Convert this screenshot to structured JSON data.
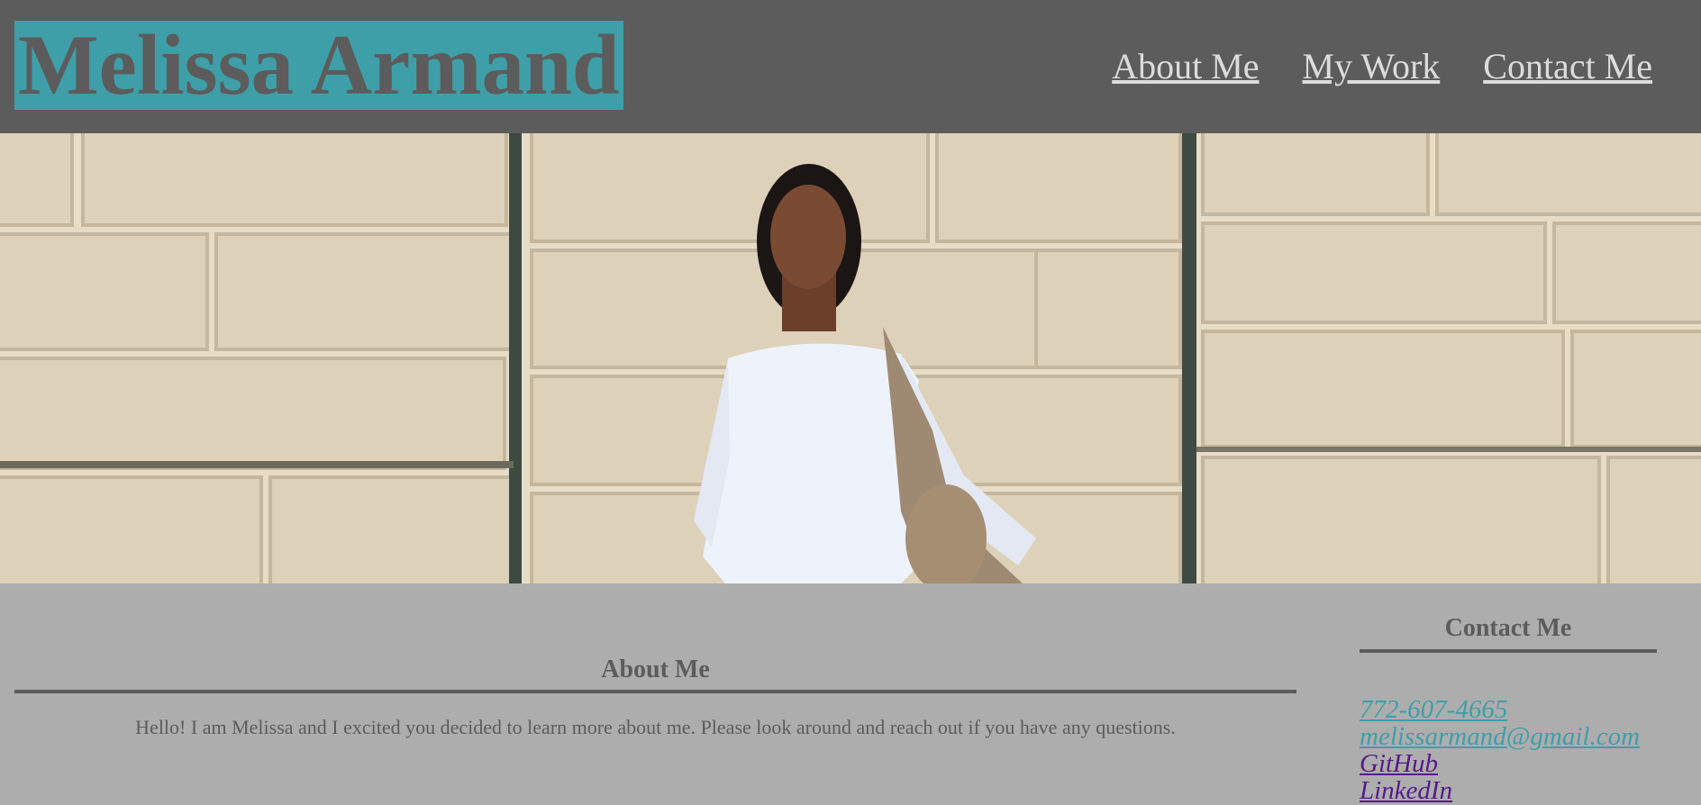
{
  "header": {
    "brand": "Melissa Armand",
    "nav": [
      "About Me",
      "My Work",
      "Contact Me"
    ]
  },
  "hero": {
    "image": "photo-of-melissa"
  },
  "about": {
    "title": "About Me",
    "text": "Hello! I am Melissa and I excited you decided to learn more about me. Please look around and reach out if you have any questions."
  },
  "contact": {
    "title": "Contact Me",
    "links": [
      "772-607-4665",
      "melissarmand@gmail.com",
      "GitHub",
      "LinkedIn"
    ]
  },
  "colors": {
    "header_bg": "#5c5c5c",
    "brand_bg": "#3e9fa8",
    "body_bg": "#adadad",
    "visited_link": "#551a8b"
  }
}
